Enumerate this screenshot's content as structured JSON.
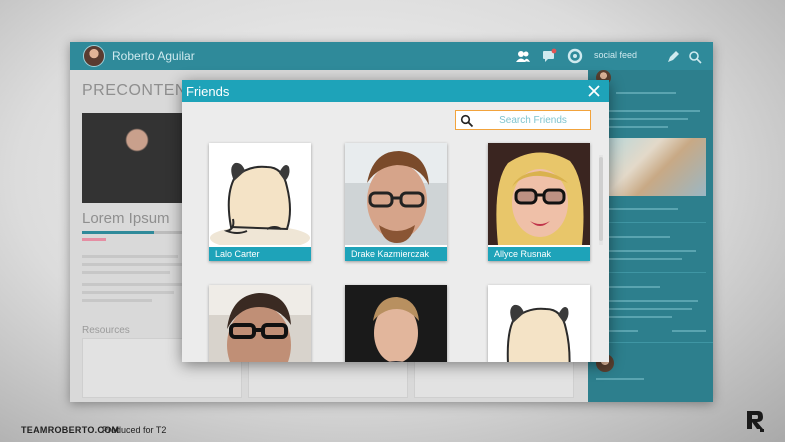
{
  "app": {
    "user_name": "Roberto Aguilar",
    "page_heading": "PRECONTENT",
    "content_title": "Lorem Ipsum",
    "progress": 0.72,
    "resources_label": "Resources",
    "social_feed_label": "social feed"
  },
  "dialog": {
    "title": "Friends",
    "search_placeholder": "Search Friends",
    "search_value": "",
    "friends": [
      {
        "name": "Lalo Carter",
        "photo": "pug-placeholder"
      },
      {
        "name": "Drake Kazmierczak",
        "photo": "photo-man-glasses"
      },
      {
        "name": "Allyce Rusnak",
        "photo": "photo-woman-glasses"
      },
      {
        "name": "",
        "photo": "photo-man-glasses-dark"
      },
      {
        "name": "",
        "photo": "photo-man-suit"
      },
      {
        "name": "",
        "photo": "pug-placeholder"
      }
    ]
  },
  "footer": {
    "brand": "TEAMROBERTO.COM",
    "produced": "Produced for T2"
  },
  "colors": {
    "dialog_accent": "#1ea3b9",
    "app_header": "#2f8a9a",
    "search_border": "#f2a33c"
  }
}
